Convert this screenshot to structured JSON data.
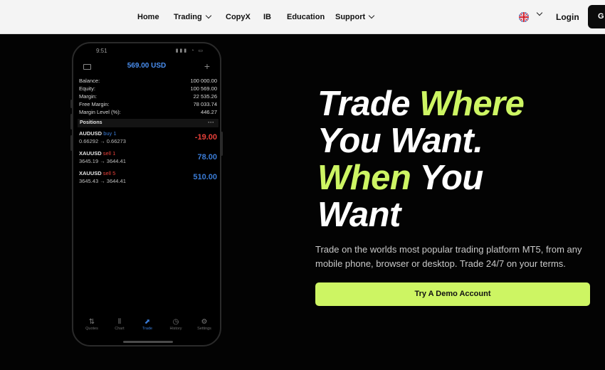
{
  "nav": {
    "items": [
      {
        "label": "Home",
        "has_dropdown": false
      },
      {
        "label": "Trading",
        "has_dropdown": true
      },
      {
        "label": "CopyX",
        "has_dropdown": false
      },
      {
        "label": "IB",
        "has_dropdown": false
      },
      {
        "label": "Education",
        "has_dropdown": false
      },
      {
        "label": "Support",
        "has_dropdown": true
      }
    ],
    "language_icon": "uk-flag-icon",
    "login_label": "Login",
    "cta_label": "G"
  },
  "phone": {
    "status_time": "9:51",
    "status_icons": "▮▮▮ ◔ ▭",
    "balance_header": "569.00 USD",
    "account": [
      {
        "label": "Balance:",
        "value": "100 000.00"
      },
      {
        "label": "Equity:",
        "value": "100 569.00"
      },
      {
        "label": "Margin:",
        "value": "22 535.26"
      },
      {
        "label": "Free Margin:",
        "value": "78 033.74"
      },
      {
        "label": "Margin Level (%):",
        "value": "446.27"
      }
    ],
    "positions_title": "Positions",
    "positions_more": "···",
    "positions": [
      {
        "symbol": "AUDUSD",
        "side": "buy 1",
        "prices": "0.66292 → 0.66273",
        "pl": "-19.00",
        "side_color": "#3a7bd5",
        "pl_color": "#e8413a"
      },
      {
        "symbol": "XAUUSD",
        "side": "sell 1",
        "prices": "3645.19 → 3644.41",
        "pl": "78.00",
        "side_color": "#e8413a",
        "pl_color": "#3a7bd5"
      },
      {
        "symbol": "XAUUSD",
        "side": "sell 5",
        "prices": "3645.43 → 3644.41",
        "pl": "510.00",
        "side_color": "#e8413a",
        "pl_color": "#3a7bd5"
      }
    ],
    "tabs": [
      {
        "label": "Quotes",
        "icon": "⇅"
      },
      {
        "label": "Chart",
        "icon": "⫴"
      },
      {
        "label": "Trade",
        "icon": "⬈"
      },
      {
        "label": "History",
        "icon": "◷"
      },
      {
        "label": "Settings",
        "icon": "⚙"
      }
    ],
    "active_tab": "Trade"
  },
  "hero": {
    "line1_a": "Trade ",
    "line1_b": "Where",
    "line2": "You Want.",
    "line3_a": "When",
    "line3_b": " You",
    "line4": "Want",
    "subtitle": "Trade on the worlds most popular trading platform MT5, from any mobile phone, browser or desktop. Trade 24/7 on your terms.",
    "cta_label": "Try A Demo Account"
  },
  "colors": {
    "accent": "#cdf563",
    "background": "#030303",
    "nav_bg": "#f4f4f4",
    "blue": "#3a7bd5",
    "red": "#e8413a"
  }
}
